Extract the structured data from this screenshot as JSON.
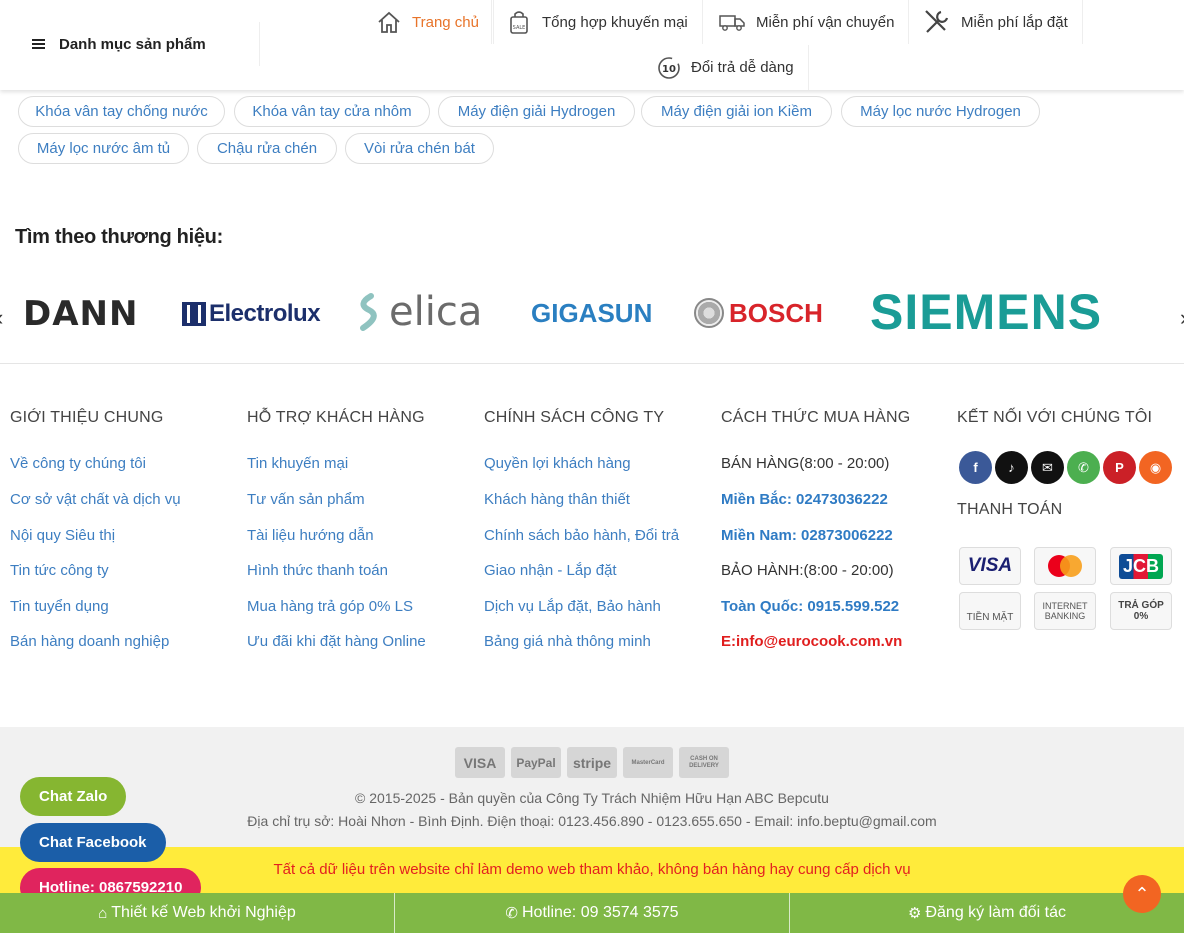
{
  "header": {
    "category_menu": "Danh mục sản phẩm",
    "nav": [
      {
        "label": "Trang chủ"
      },
      {
        "label": "Tổng hợp khuyến mại"
      },
      {
        "label": "Miễn phí vận chuyển"
      },
      {
        "label": "Miễn phí lắp đặt"
      },
      {
        "label": "Đổi trả dễ dàng"
      }
    ]
  },
  "tags": [
    "Khóa vân tay chống nước",
    "Khóa vân tay cửa nhôm",
    "Máy điện giải Hydrogen",
    "Máy điện giải ion Kiềm",
    "Máy lọc nước Hydrogen",
    "Máy lọc nước âm tủ",
    "Chậu rửa chén",
    "Vòi rửa chén bát"
  ],
  "brands": {
    "title": "Tìm theo thương hiệu:",
    "items": [
      "DANN",
      "Electrolux",
      "elica",
      "GIGASUN",
      "BOSCH",
      "SIEMENS"
    ]
  },
  "footer": {
    "col1": {
      "title": "GIỚI THIỆU CHUNG",
      "links": [
        "Về công ty chúng tôi",
        "Cơ sở vật chất và dịch vụ",
        "Nội quy Siêu thị",
        "Tin tức công ty",
        "Tin tuyển dụng",
        "Bán hàng doanh nghiệp"
      ]
    },
    "col2": {
      "title": "HỖ TRỢ KHÁCH HÀNG",
      "links": [
        "Tin khuyến mại",
        "Tư vấn sản phẩm",
        "Tài liệu hướng dẫn",
        "Hình thức thanh toán",
        "Mua hàng trả góp 0% LS",
        "Ưu đãi khi đặt hàng Online"
      ]
    },
    "col3": {
      "title": "CHÍNH SÁCH CÔNG TY",
      "links": [
        "Quyền lợi khách hàng",
        "Khách hàng thân thiết",
        "Chính sách bảo hành, Đổi trả",
        "Giao nhận - Lắp đặt",
        "Dịch vụ Lắp đặt, Bảo hành",
        "Bảng giá nhà thông minh"
      ]
    },
    "col4": {
      "title": "CÁCH THỨC MUA HÀNG",
      "sales": "BÁN HÀNG(8:00 - 20:00)",
      "north": "Miền Bắc: 02473036222",
      "south": "Miền Nam: 02873006222",
      "warranty": "BẢO HÀNH:(8:00 - 20:00)",
      "national": "Toàn Quốc: 0915.599.522",
      "email": "E:info@eurocook.com.vn"
    },
    "col5": {
      "title": "KẾT NỐI VỚI CHÚNG TÔI",
      "payment_title": "THANH TOÁN",
      "social": [
        {
          "icon": "facebook-icon",
          "glyph": "f",
          "color": "#3b5998"
        },
        {
          "icon": "tiktok-icon",
          "glyph": "♪",
          "color": "#111111"
        },
        {
          "icon": "email-icon",
          "glyph": "✉",
          "color": "#111111"
        },
        {
          "icon": "phone-icon",
          "glyph": "✆",
          "color": "#4caf50"
        },
        {
          "icon": "pinterest-icon",
          "glyph": "P",
          "color": "#cb2027"
        },
        {
          "icon": "rss-icon",
          "glyph": "◉",
          "color": "#f26522"
        }
      ],
      "payments": [
        "VISA",
        "",
        "JCB",
        "TIỀN MẶT",
        "INTERNET BANKING",
        "TRẢ GÓP 0%"
      ]
    }
  },
  "bottom": {
    "cards": [
      "VISA",
      "PayPal",
      "stripe",
      "MasterCard",
      "CASH ON DELIVERY"
    ],
    "copyright": "© 2015-2025 - Bản quyền của Công Ty Trách Nhiệm Hữu Hạn ABC Bepcutu",
    "address": "Địa chỉ trụ sở: Hoài Nhơn - Bình Định. Điện thoại: 0123.456.890 - 0123.655.650 - Email: info.beptu@gmail.com",
    "notice": "Tất cả dữ liệu trên website chỉ làm demo web tham khảo, không bán hàng hay cung cấp dịch vụ"
  },
  "float_buttons": {
    "zalo": "Chat Zalo",
    "facebook": "Chat Facebook",
    "hotline": "Hotline: 0867592210"
  },
  "colors": {
    "zalo": "#86b631",
    "facebook": "#1b5ea8",
    "hotline": "#e0245e",
    "bar": "#80b846",
    "accent": "#e8742a",
    "link": "#3d7ec1"
  },
  "bottom_bar": [
    {
      "icon": "home-icon",
      "label": "Thiết kế Web khởi Nghiệp"
    },
    {
      "icon": "phone-icon",
      "label": "Hotline: 09 3574 3575"
    },
    {
      "icon": "gear-icon",
      "label": "Đăng ký làm đối tác"
    }
  ]
}
